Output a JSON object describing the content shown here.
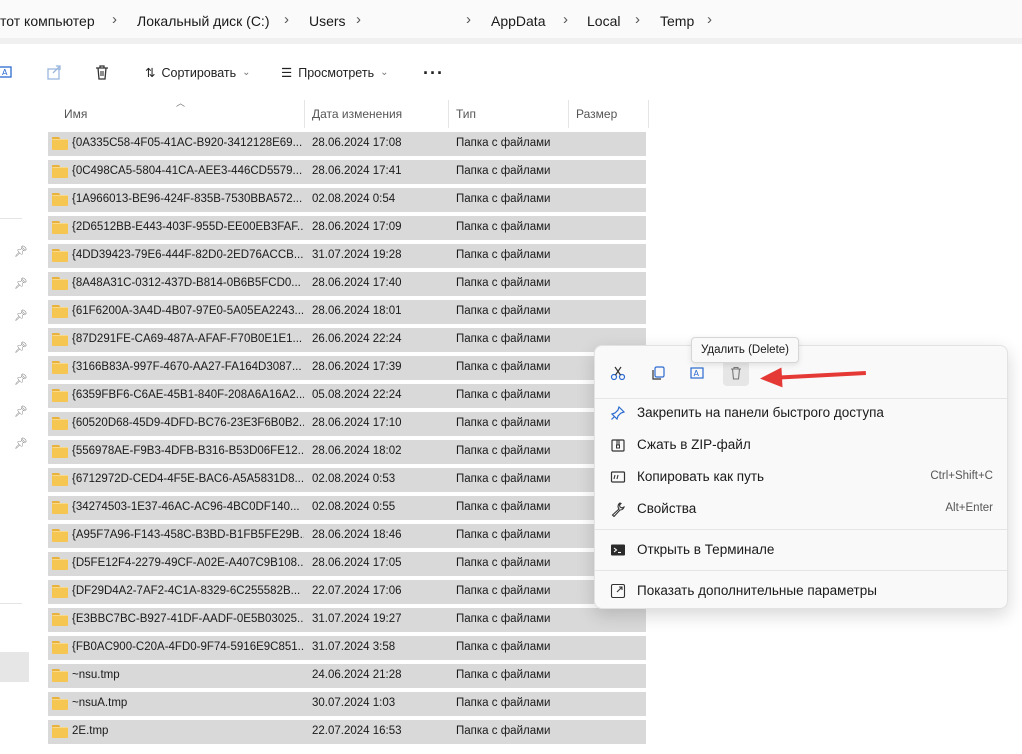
{
  "breadcrumb": {
    "items": [
      "тот компьютер",
      "Локальный диск (C:)",
      "Users",
      "AppData",
      "Local",
      "Temp"
    ],
    "separator": "›"
  },
  "toolbar": {
    "sort_label": "Сортировать",
    "view_label": "Просмотреть",
    "more_label": "···",
    "rename_icon": "rename-icon",
    "share_icon": "share-icon",
    "delete_icon": "trash-icon"
  },
  "columns": {
    "name": "Имя",
    "date": "Дата изменения",
    "type": "Тип",
    "size": "Размер"
  },
  "rows": [
    {
      "name": "{0A335C58-4F05-41AC-B920-3412128E69...",
      "date": "28.06.2024 17:08",
      "type": "Папка с файлами"
    },
    {
      "name": "{0C498CA5-5804-41CA-AEE3-446CD5579...",
      "date": "28.06.2024 17:41",
      "type": "Папка с файлами"
    },
    {
      "name": "{1A966013-BE96-424F-835B-7530BBA572...",
      "date": "02.08.2024 0:54",
      "type": "Папка с файлами"
    },
    {
      "name": "{2D6512BB-E443-403F-955D-EE00EB3FAF...",
      "date": "28.06.2024 17:09",
      "type": "Папка с файлами"
    },
    {
      "name": "{4DD39423-79E6-444F-82D0-2ED76ACCB...",
      "date": "31.07.2024 19:28",
      "type": "Папка с файлами"
    },
    {
      "name": "{8A48A31C-0312-437D-B814-0B6B5FCD0...",
      "date": "28.06.2024 17:40",
      "type": "Папка с файлами"
    },
    {
      "name": "{61F6200A-3A4D-4B07-97E0-5A05EA2243...",
      "date": "28.06.2024 18:01",
      "type": "Папка с файлами"
    },
    {
      "name": "{87D291FE-CA69-487A-AFAF-F70B0E1E1...",
      "date": "26.06.2024 22:24",
      "type": "Папка с файлами"
    },
    {
      "name": "{3166B83A-997F-4670-AA27-FA164D3087...",
      "date": "28.06.2024 17:39",
      "type": "Папка с файлами"
    },
    {
      "name": "{6359FBF6-C6AE-45B1-840F-208A6A16A2...",
      "date": "05.08.2024 22:24",
      "type": "Папка с файлами"
    },
    {
      "name": "{60520D68-45D9-4DFD-BC76-23E3F6B0B2...",
      "date": "28.06.2024 17:10",
      "type": "Папка с файлами"
    },
    {
      "name": "{556978AE-F9B3-4DFB-B316-B53D06FE12...",
      "date": "28.06.2024 18:02",
      "type": "Папка с файлами"
    },
    {
      "name": "{6712972D-CED4-4F5E-BAC6-A5A5831D8...",
      "date": "02.08.2024 0:53",
      "type": "Папка с файлами"
    },
    {
      "name": "{34274503-1E37-46AC-AC96-4BC0DF140...",
      "date": "02.08.2024 0:55",
      "type": "Папка с файлами"
    },
    {
      "name": "{A95F7A96-F143-458C-B3BD-B1FB5FE29B...",
      "date": "28.06.2024 18:46",
      "type": "Папка с файлами"
    },
    {
      "name": "{D5FE12F4-2279-49CF-A02E-A407C9B108...",
      "date": "28.06.2024 17:05",
      "type": "Папка с файлами"
    },
    {
      "name": "{DF29D4A2-7AF2-4C1A-8329-6C255582B...",
      "date": "22.07.2024 17:06",
      "type": "Папка с файлами"
    },
    {
      "name": "{E3BBC7BC-B927-41DF-AADF-0E5B03025...",
      "date": "31.07.2024 19:27",
      "type": "Папка с файлами"
    },
    {
      "name": "{FB0AC900-C20A-4FD0-9F74-5916E9C851...",
      "date": "31.07.2024 3:58",
      "type": "Папка с файлами"
    },
    {
      "name": "~nsu.tmp",
      "date": "24.06.2024 21:28",
      "type": "Папка с файлами"
    },
    {
      "name": "~nsuA.tmp",
      "date": "30.07.2024 1:03",
      "type": "Папка с файлами"
    },
    {
      "name": "2E.tmp",
      "date": "22.07.2024 16:53",
      "type": "Папка с файлами"
    }
  ],
  "context_menu": {
    "tooltip": "Удалить (Delete)",
    "quick_icons": [
      "cut-icon",
      "copy-icon",
      "rename-icon",
      "delete-icon"
    ],
    "items": [
      {
        "label": "Закрепить на панели быстрого доступа",
        "shortcut": "",
        "icon": "pin-icon"
      },
      {
        "label": "Сжать в ZIP-файл",
        "shortcut": "",
        "icon": "zip-icon"
      },
      {
        "label": "Копировать как путь",
        "shortcut": "Ctrl+Shift+C",
        "icon": "copy-path-icon"
      },
      {
        "label": "Свойства",
        "shortcut": "Alt+Enter",
        "icon": "wrench-icon"
      },
      {
        "label": "Открыть в Терминале",
        "shortcut": "",
        "icon": "terminal-icon"
      },
      {
        "label": "Показать дополнительные параметры",
        "shortcut": "",
        "icon": "more-options-icon"
      }
    ]
  },
  "colors": {
    "selection": "#d9d9d9",
    "folder": "#f6c652",
    "accent": "#2b6bd1",
    "arrow": "#e53935"
  }
}
